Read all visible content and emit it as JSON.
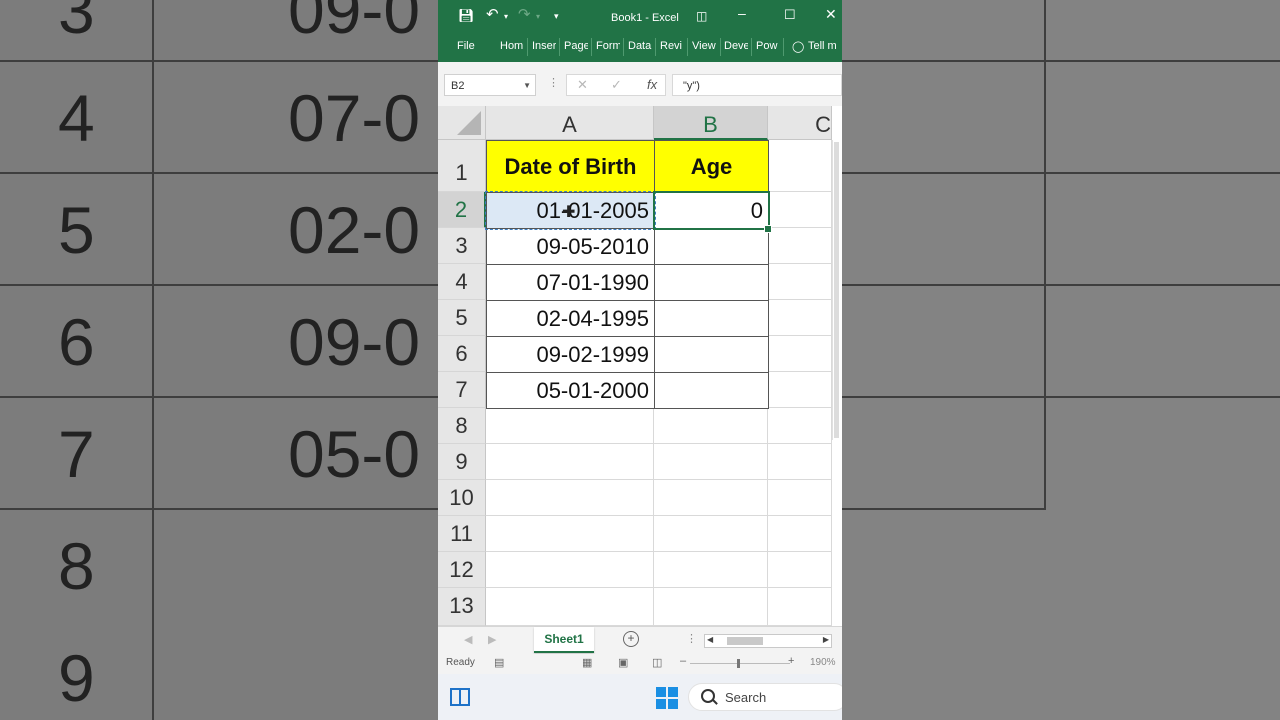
{
  "background": {
    "row_numbers": [
      "3",
      "4",
      "5",
      "6",
      "7",
      "8",
      "9"
    ],
    "date_fragments": [
      "09-0",
      "07-0",
      "02-0",
      "09-0",
      "05-0"
    ]
  },
  "window": {
    "title": "Book1 - Excel",
    "ribbon_tabs": [
      "File",
      "Hom",
      "Inser",
      "Page",
      "Form",
      "Data",
      "Revi",
      "View",
      "Deve",
      "Pow",
      "Tell m"
    ]
  },
  "formula_bar": {
    "name_box": "B2",
    "cancel_icon": "✕",
    "enter_icon": "✓",
    "fx_label": "fx",
    "formula": "\"y\")"
  },
  "columns": [
    "A",
    "B",
    "C"
  ],
  "rows": [
    "1",
    "2",
    "3",
    "4",
    "5",
    "6",
    "7",
    "8",
    "9",
    "10",
    "11",
    "12",
    "13"
  ],
  "table": {
    "headers": [
      "Date of Birth",
      "Age"
    ],
    "rows": [
      [
        "01-01-2005",
        "0"
      ],
      [
        "09-05-2010",
        ""
      ],
      [
        "07-01-1990",
        ""
      ],
      [
        "02-04-1995",
        ""
      ],
      [
        "09-02-1999",
        ""
      ],
      [
        "05-01-2000",
        ""
      ]
    ]
  },
  "colors": {
    "excel_green": "#217346",
    "header_fill": "#ffff00",
    "selection": "#217346"
  },
  "sheets": {
    "active": "Sheet1"
  },
  "status": {
    "ready": "Ready",
    "zoom": "190%"
  },
  "taskbar": {
    "search_placeholder": "Search"
  }
}
